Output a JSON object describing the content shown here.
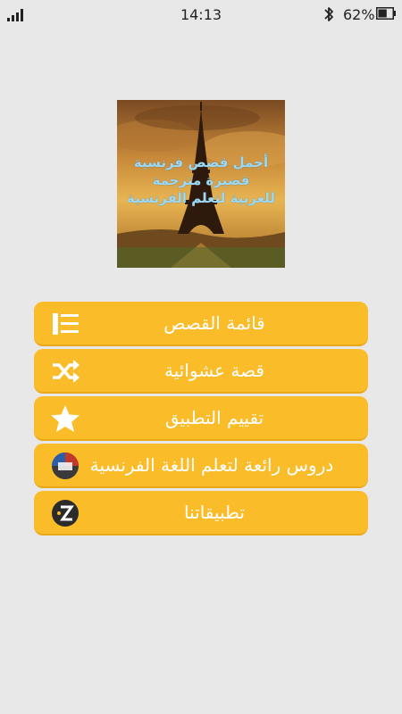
{
  "status_bar": {
    "time": "14:13",
    "battery_percent": "62%",
    "battery_level": 0.62,
    "icons": [
      "signal-icon",
      "bluetooth-icon",
      "battery-icon"
    ]
  },
  "hero": {
    "caption_lines": [
      "أجمل قصص فرنسية",
      "قصيرة مترجمة",
      "للعربية لتعلم الفرنسية"
    ],
    "image_subject": "eiffel-tower"
  },
  "menu": {
    "items": [
      {
        "label": "قائمة القصص",
        "icon": "list-icon"
      },
      {
        "label": "قصة عشوائية",
        "icon": "shuffle-icon"
      },
      {
        "label": "تقييم التطبيق",
        "icon": "star-icon"
      },
      {
        "label": "دروس رائعة لتعلم اللغة الفرنسية",
        "icon": "french-lessons-app-icon"
      },
      {
        "label": "تطبيقاتنا",
        "icon": "our-apps-icon"
      }
    ]
  },
  "colors": {
    "background": "#e8e8e8",
    "button": "#fbbc2a",
    "button_text": "#ffffff",
    "caption": "#9ed8f2"
  }
}
